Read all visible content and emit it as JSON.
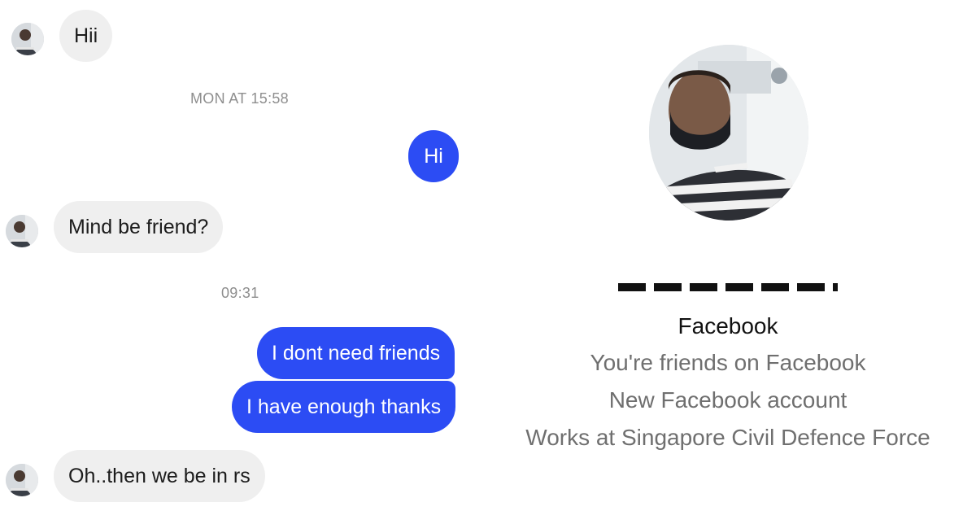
{
  "chat": {
    "messages": [
      {
        "direction": "incoming",
        "text": "Hii"
      },
      {
        "type": "timestamp",
        "text": "MON AT 15:58"
      },
      {
        "direction": "outgoing",
        "text": "Hi"
      },
      {
        "direction": "incoming",
        "text": "Mind be friend?"
      },
      {
        "type": "timestamp",
        "text": "09:31"
      },
      {
        "direction": "outgoing",
        "text": "I dont need friends"
      },
      {
        "direction": "outgoing",
        "text": "I have enough thanks"
      },
      {
        "direction": "incoming",
        "text": "Oh..then we be in rs"
      }
    ]
  },
  "profile": {
    "platform": "Facebook",
    "relationship": "You're friends on Facebook",
    "account_status": "New Facebook account",
    "work": "Works at Singapore Civil Defence Force"
  },
  "colors": {
    "outgoing_bubble": "#2c4cf4",
    "incoming_bubble": "#efefef",
    "timestamp_text": "#8e8e8e",
    "secondary_text": "#6f6f6f"
  },
  "icons": {
    "sender_avatar": "avatar-icon"
  }
}
